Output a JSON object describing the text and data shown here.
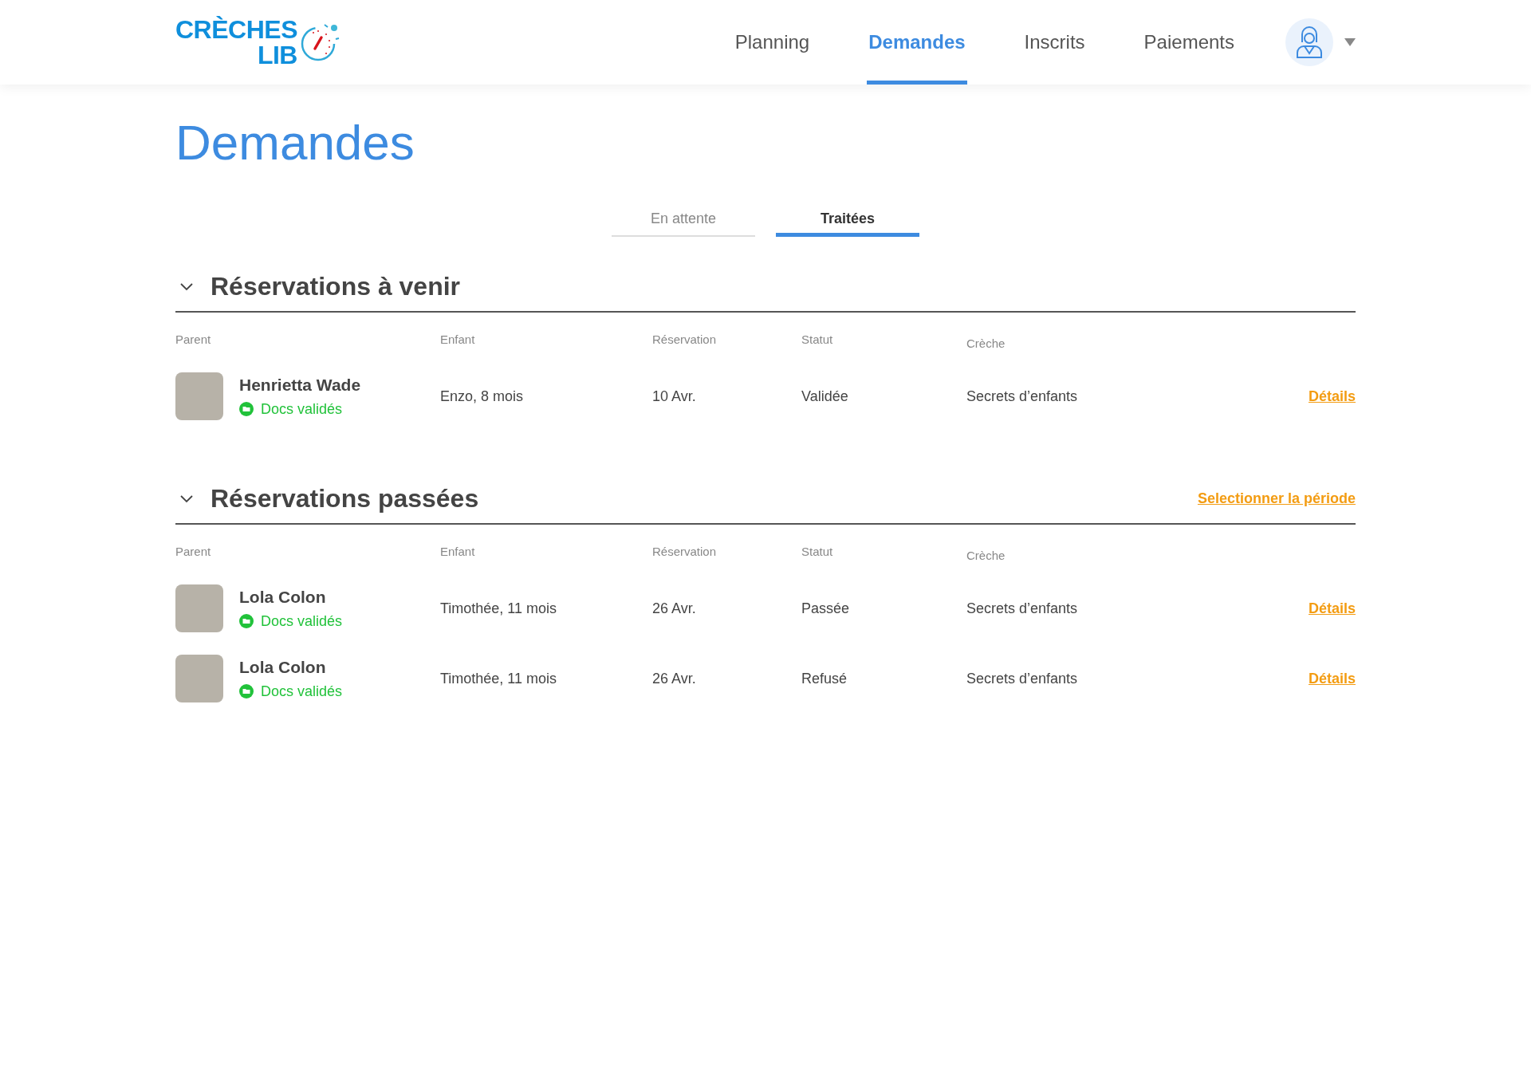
{
  "header": {
    "logo": {
      "line_1": "CRÈCHES",
      "line_2": "LIB"
    },
    "nav": [
      {
        "label": "Planning",
        "selected": false
      },
      {
        "label": "Demandes",
        "selected": true
      },
      {
        "label": "Inscrits",
        "selected": false
      },
      {
        "label": "Paiements",
        "selected": false
      }
    ]
  },
  "page_title": "Demandes",
  "tabs": [
    {
      "label": "En attente",
      "selected": false
    },
    {
      "label": "Traitées",
      "selected": true
    }
  ],
  "sections": [
    {
      "title": "Réservations à venir",
      "expanded": true,
      "columns": [
        "Parent",
        "Enfant",
        "Réservation",
        "Statut",
        "Crèche"
      ],
      "rows": [
        {
          "parent": "Henrietta Wade",
          "docs": "Docs validés",
          "child": "Enzo, 8 mois",
          "date": "10 Avr.",
          "status": "Validée",
          "creche": "Secrets d’enfants",
          "link": "Détails"
        }
      ]
    },
    {
      "title": "Réservations passées",
      "expanded": true,
      "action": "Selectionner la période",
      "columns": [
        "Parent",
        "Enfant",
        "Réservation",
        "Statut",
        "Crèche"
      ],
      "rows": [
        {
          "parent": "Lola Colon",
          "docs": "Docs validés",
          "child": "Timothée, 11 mois",
          "date": "26 Avr.",
          "status": "Passée",
          "creche": "Secrets d’enfants",
          "link": "Détails"
        },
        {
          "parent": "Lola Colon",
          "docs": "Docs validés",
          "child": "Timothée, 11 mois",
          "date": "26 Avr.",
          "status": "Refusé",
          "creche": "Secrets d’enfants",
          "link": "Détails"
        }
      ]
    }
  ]
}
